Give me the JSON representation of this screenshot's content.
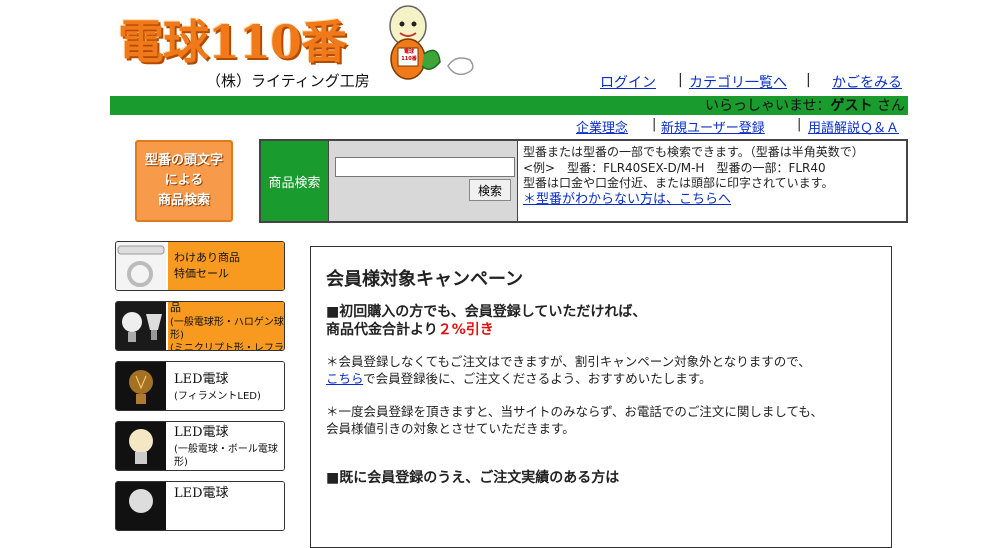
{
  "header": {
    "logo_text": "電球110番",
    "mascot_badge": "電球\n110番",
    "company": "（株）ライティング工房",
    "nav": [
      "ログイン",
      "カテゴリ一覧へ",
      "かごをみる"
    ],
    "welcome_prefix": "いらっしゃいませ：",
    "welcome_user": "ゲスト",
    "welcome_suffix": " さん",
    "subnav": [
      "企業理念",
      "新規ユーザー登録",
      "用語解説Ｑ＆Ａ"
    ]
  },
  "search": {
    "prefix_button": "型番の頭文字\nによる\n商品検索",
    "label": "商品検索",
    "input_value": "",
    "button": "検索",
    "help_lines": [
      "型番または型番の一部でも検索できます。（型番は半角英数で）",
      "<例>　型番：FLR40SEX-D/M-H　型番の一部：FLR40",
      "型番は口金や口金付近、または頭部に印字されています。"
    ],
    "help_link": "＊型番がわからない方は、こちらへ"
  },
  "sidebar": {
    "items": [
      {
        "line1": "わけあり商品",
        "line2": "特価セール",
        "style": "orange"
      },
      {
        "line1": "ＬＥＤ電球超お買い得品",
        "line2": "(一般電球形・ハロゲン球形)",
        "line3": "(ミニクリプト形・レフランプ形)",
        "style": "orange"
      },
      {
        "line1": "LED電球",
        "line2": "(フィラメントLED)",
        "style": "white"
      },
      {
        "line1": "LED電球",
        "line2": "(一般電球・ボール電球形)",
        "style": "white"
      },
      {
        "line1": "LED電球",
        "line2": "",
        "style": "white"
      }
    ]
  },
  "campaign": {
    "title": "会員様対象キャンペーン",
    "p1_line1": "■初回購入の方でも、会員登録していただければ、",
    "p1_line2_prefix": "商品代金合計より",
    "p1_highlight": "２%引き",
    "note1_line1": "＊会員登録しなくてもご注文はできますが、割引キャンペーン対象外となりますので、",
    "note1_link": "こちら",
    "note1_line2_rest": "で会員登録後に、ご注文くださるよう、おすすめいたします。",
    "note2_line1": "＊一度会員登録を頂きますと、当サイトのみならず、お電話でのご注文に関しましても、",
    "note2_line2": "会員様値引きの対象とさせていただきます。",
    "p2": "■既に会員登録のうえ、ご注文実績のある方は"
  },
  "colors": {
    "green": "#1a9b2e",
    "orange": "#f99a20",
    "link": "#0a2fc9",
    "highlight_red": "#e01010"
  }
}
